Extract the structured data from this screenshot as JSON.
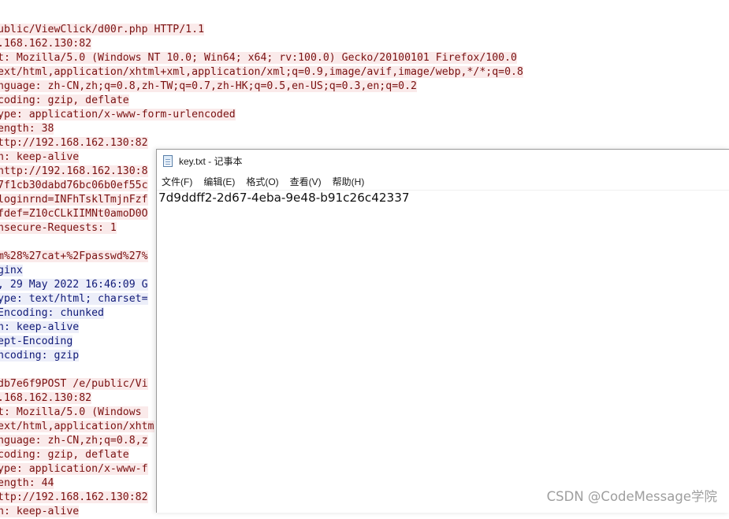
{
  "http_stream": {
    "lines": [
      {
        "kind": "req",
        "text": "ublic/ViewClick/d00r.php HTTP/1.1"
      },
      {
        "kind": "req",
        "text": ".168.162.130:82"
      },
      {
        "kind": "req",
        "text": "t: Mozilla/5.0 (Windows NT 10.0; Win64; x64; rv:100.0) Gecko/20100101 Firefox/100.0"
      },
      {
        "kind": "req",
        "text": "ext/html,application/xhtml+xml,application/xml;q=0.9,image/avif,image/webp,*/*;q=0.8"
      },
      {
        "kind": "req",
        "text": "nguage: zh-CN,zh;q=0.8,zh-TW;q=0.7,zh-HK;q=0.5,en-US;q=0.3,en;q=0.2"
      },
      {
        "kind": "req",
        "text": "coding: gzip, deflate"
      },
      {
        "kind": "req",
        "text": "ype: application/x-www-form-urlencoded"
      },
      {
        "kind": "req",
        "text": "ength: 38"
      },
      {
        "kind": "req",
        "text": "ttp://192.168.162.130:82"
      },
      {
        "kind": "req",
        "text": "n: keep-alive"
      },
      {
        "kind": "req",
        "text": "http://192.168.162.130:8"
      },
      {
        "kind": "req",
        "text": "7f1cb30dabd76bc06b0ef55c"
      },
      {
        "kind": "req",
        "text": "loginrnd=INFhTsklTmjnFzf"
      },
      {
        "kind": "req",
        "text": "fdef=Z10cCLkIIMNt0amoD0O"
      },
      {
        "kind": "req",
        "text": "nsecure-Requests: 1"
      },
      {
        "kind": "blank",
        "text": ""
      },
      {
        "kind": "req",
        "text": "m%28%27cat+%2Fpasswd%27%"
      },
      {
        "kind": "resp",
        "text": "ginx"
      },
      {
        "kind": "resp",
        "text": ", 29 May 2022 16:46:09 G"
      },
      {
        "kind": "resp",
        "text": "ype: text/html; charset="
      },
      {
        "kind": "resp",
        "text": "Encoding: chunked"
      },
      {
        "kind": "resp",
        "text": "n: keep-alive"
      },
      {
        "kind": "resp",
        "text": "ept-Encoding"
      },
      {
        "kind": "resp",
        "text": "ncoding: gzip"
      },
      {
        "kind": "blank",
        "text": ""
      },
      {
        "kind": "req",
        "text": "db7e6f9POST /e/public/Vi"
      },
      {
        "kind": "req",
        "text": ".168.162.130:82"
      },
      {
        "kind": "req",
        "text": "t: Mozilla/5.0 (Windows "
      },
      {
        "kind": "req",
        "text": "ext/html,application/xhtm"
      },
      {
        "kind": "req",
        "text": "nguage: zh-CN,zh;q=0.8,z"
      },
      {
        "kind": "req",
        "text": "coding: gzip, deflate"
      },
      {
        "kind": "req",
        "text": "ype: application/x-www-f"
      },
      {
        "kind": "req",
        "text": "ength: 44"
      },
      {
        "kind": "req",
        "text": "ttp://192.168.162.130:82"
      },
      {
        "kind": "req",
        "text": "n: keep-alive"
      }
    ]
  },
  "notepad": {
    "title": "key.txt - 记事本",
    "menu": [
      "文件(F)",
      "编辑(E)",
      "格式(O)",
      "查看(V)",
      "帮助(H)"
    ],
    "content": "7d9ddff2-2d67-4eba-9e48-b91c26c42337"
  },
  "watermark": "CSDN @CodeMessage学院",
  "colors": {
    "request_text": "#7a1111",
    "request_bg": "#faeaea",
    "response_text": "#101a78",
    "response_bg": "#eceef9"
  }
}
